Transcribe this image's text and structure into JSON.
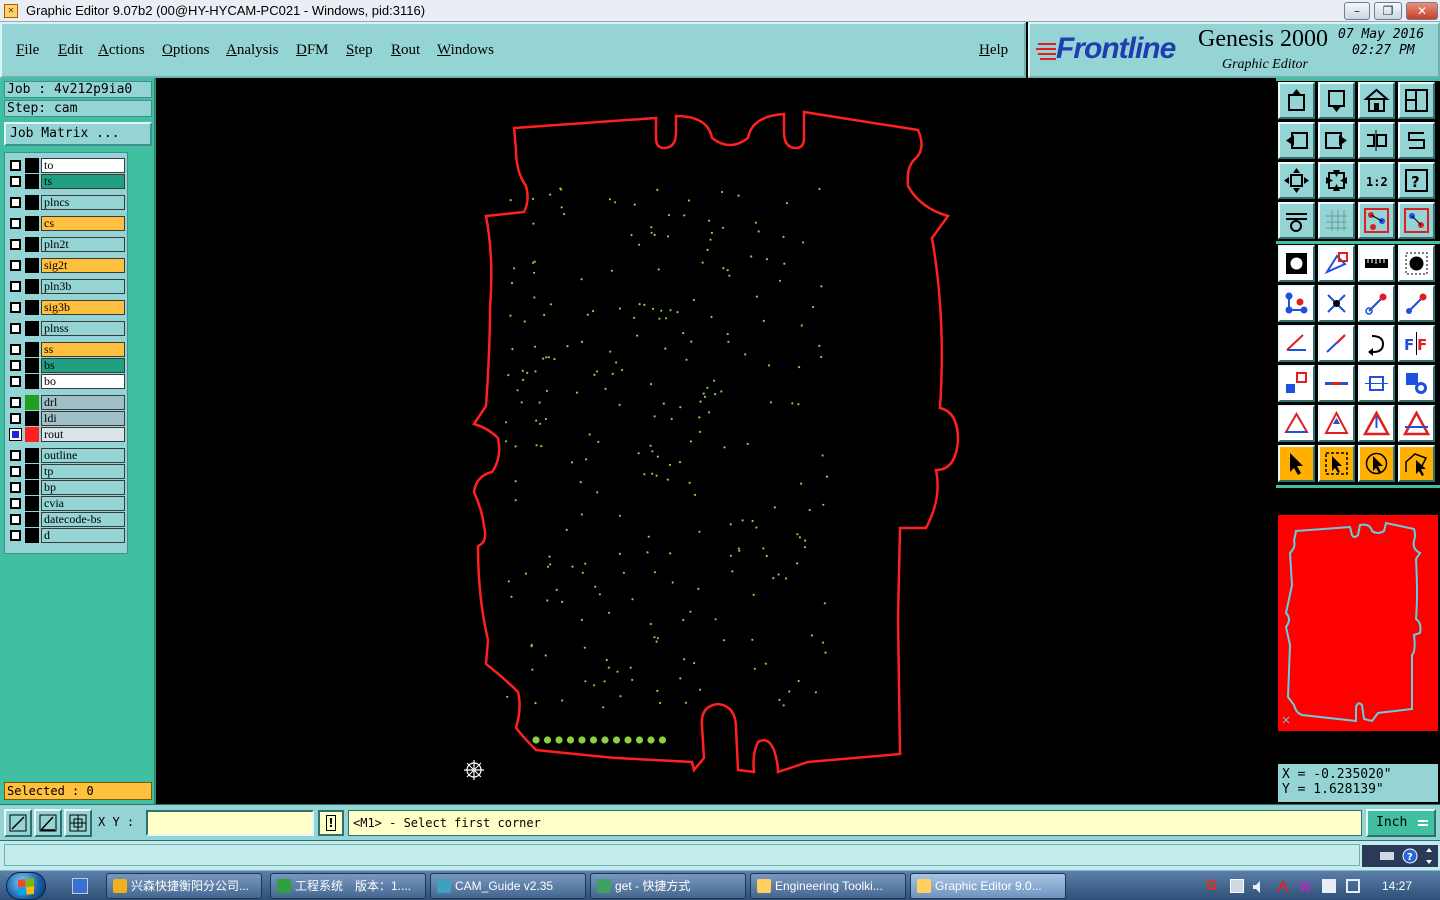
{
  "window": {
    "title": "Graphic Editor 9.07b2 (00@HY-HYCAM-PC021 - Windows, pid:3116)",
    "controls": [
      "–",
      "❐",
      "✕"
    ]
  },
  "menu": {
    "items": [
      "File",
      "Edit",
      "Actions",
      "Options",
      "Analysis",
      "DFM",
      "Step",
      "Rout",
      "Windows"
    ],
    "help": "Help"
  },
  "brand": {
    "logo": "Frontline",
    "product": "Genesis 2000",
    "edition": "Graphic Editor",
    "date": "07 May 2016",
    "time": "02:27 PM"
  },
  "job": {
    "job_line": "Job : 4v212p9ia0",
    "step_line": "Step: cam",
    "matrix_button": "Job Matrix ..."
  },
  "layers": [
    {
      "name": "to",
      "color": "#ffffff",
      "swatch": "#000000",
      "active": false
    },
    {
      "name": "ts",
      "color": "#20a080",
      "swatch": "#000000",
      "active": false
    },
    {
      "name": "plncs",
      "color": "#94d4d4",
      "swatch": "#000000",
      "active": false
    },
    {
      "name": "cs",
      "color": "#ffc040",
      "swatch": "#000000",
      "active": false
    },
    {
      "name": "pln2t",
      "color": "#94d4d4",
      "swatch": "#000000",
      "active": false
    },
    {
      "name": "sig2t",
      "color": "#ffc040",
      "swatch": "#000000",
      "active": false
    },
    {
      "name": "pln3b",
      "color": "#94d4d4",
      "swatch": "#000000",
      "active": false
    },
    {
      "name": "sig3b",
      "color": "#ffc040",
      "swatch": "#000000",
      "active": false
    },
    {
      "name": "plnss",
      "color": "#94d4d4",
      "swatch": "#000000",
      "active": false
    },
    {
      "name": "ss",
      "color": "#ffc040",
      "swatch": "#000000",
      "active": false
    },
    {
      "name": "bs",
      "color": "#20a080",
      "swatch": "#000000",
      "active": false
    },
    {
      "name": "bo",
      "color": "#ffffff",
      "swatch": "#000000",
      "active": false
    },
    {
      "name": "drl",
      "color": "#a0c0c8",
      "swatch": "#20a020",
      "active": false
    },
    {
      "name": "ldi",
      "color": "#a0c0c8",
      "swatch": "#000000",
      "active": false
    },
    {
      "name": "rout",
      "color": "#d8e4e8",
      "swatch": "#ff2020",
      "active": true
    },
    {
      "name": "outline",
      "color": "#94d4d4",
      "swatch": "#000000",
      "active": false
    },
    {
      "name": "tp",
      "color": "#94d4d4",
      "swatch": "#000000",
      "active": false
    },
    {
      "name": "bp",
      "color": "#94d4d4",
      "swatch": "#000000",
      "active": false
    },
    {
      "name": "cvia",
      "color": "#94d4d4",
      "swatch": "#000000",
      "active": false
    },
    {
      "name": "datecode-bs",
      "color": "#94d4d4",
      "swatch": "#000000",
      "active": false
    },
    {
      "name": "d",
      "color": "#94d4d4",
      "swatch": "#000000",
      "active": false
    }
  ],
  "selected_text": "Selected : 0",
  "coords": {
    "x_line": "X = -0.235020\"",
    "y_line": "Y = 1.628139\""
  },
  "command": {
    "xy_label": "X Y :",
    "xy_value": "",
    "warn_icon": "!",
    "prompt": "<M1> - Select first corner",
    "unit": "Inch"
  },
  "colors": {
    "rout_outline": "#ff2020",
    "drill_points": "#8ad040",
    "panel_bg": "#94d4d4",
    "panel_dark": "#40c0a0",
    "highlight": "#ffc040"
  },
  "taskbar": {
    "tasks": [
      {
        "label": "兴森快捷衡阳分公司...",
        "icon": "star-icon",
        "color": "#f0b020"
      },
      {
        "label": "工程系统　版本：1....",
        "icon": "p-icon",
        "color": "#30a040"
      },
      {
        "label": "CAM_Guide v2.35",
        "icon": "eye-icon",
        "color": "#40a0c0"
      },
      {
        "label": "get - 快捷方式",
        "icon": "globe-icon",
        "color": "#40a060"
      },
      {
        "label": "Engineering Toolki...",
        "icon": "x-icon",
        "color": "#ffd060"
      },
      {
        "label": "Graphic Editor 9.0...",
        "icon": "x-icon",
        "color": "#ffd060"
      }
    ],
    "clock": "14:27"
  }
}
